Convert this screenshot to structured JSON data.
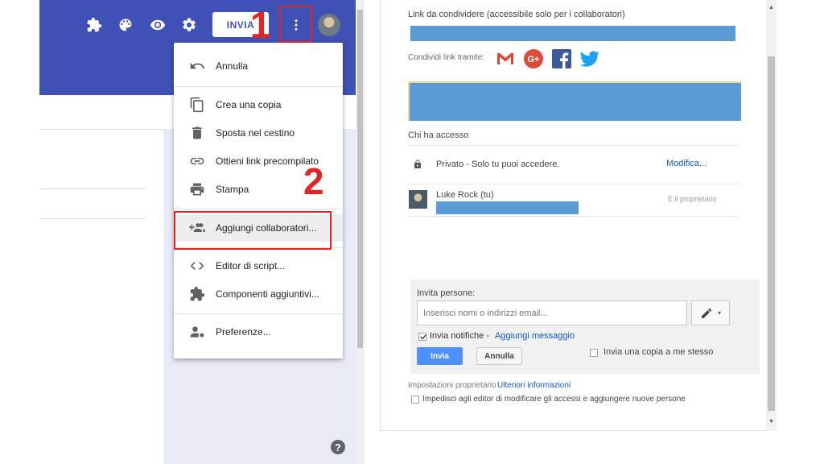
{
  "forms_editor": {
    "header": {
      "send_button_label": "INVIA",
      "icons": [
        "puzzle-icon",
        "palette-icon",
        "eye-icon",
        "gear-icon",
        "more-vert-icon"
      ],
      "header_color": "#3f51b5"
    },
    "annotations": {
      "step1": "1",
      "step2": "2",
      "highlight_color": "#e32424"
    },
    "menu": {
      "items": [
        {
          "label": "Annulla",
          "icon": "undo-icon"
        },
        {
          "label": "Crea una copia",
          "icon": "copy-icon"
        },
        {
          "label": "Sposta nel cestino",
          "icon": "trash-icon"
        },
        {
          "label": "Ottieni link precompilato",
          "icon": "link-icon"
        },
        {
          "label": "Stampa",
          "icon": "print-icon"
        },
        {
          "label": "Aggiungi collaboratori...",
          "icon": "add-people-icon"
        },
        {
          "label": "Editor di script...",
          "icon": "code-icon"
        },
        {
          "label": "Componenti aggiuntivi...",
          "icon": "puzzle-icon"
        },
        {
          "label": "Preferenze...",
          "icon": "person-settings-icon"
        }
      ]
    },
    "help_label": "?"
  },
  "share_dialog": {
    "link_label": "Link da condividere (accessibile solo per i collaboratori)",
    "share_via_label": "Condividi link tramite:",
    "share_icons": [
      "gmail-icon",
      "google-plus-icon",
      "facebook-icon",
      "twitter-icon"
    ],
    "access_heading": "Chi ha accesso",
    "privacy": {
      "text": "Privato - Solo tu puoi accedere.",
      "modify_link": "Modifica..."
    },
    "owner": {
      "name": "Luke Rock (tu)",
      "role": "È il proprietario"
    },
    "invite": {
      "label": "Invita persone:",
      "placeholder": "Inserisci nomi o indirizzi email...",
      "notify_label": "Invia notifiche -",
      "add_message_link": "Aggiungi messaggio",
      "send_button": "Invia",
      "cancel_button": "Annulla",
      "copy_to_me_label": "Invia una copia a me stesso"
    },
    "owner_settings": {
      "label": "Impostazioni proprietario",
      "more_info_link": "Ulteriori informazioni",
      "prevent_editors_label": "Impedisci agli editor di modificare gli accessi e aggiungere nuove persone"
    },
    "redaction_color": "#5b9bd5"
  }
}
